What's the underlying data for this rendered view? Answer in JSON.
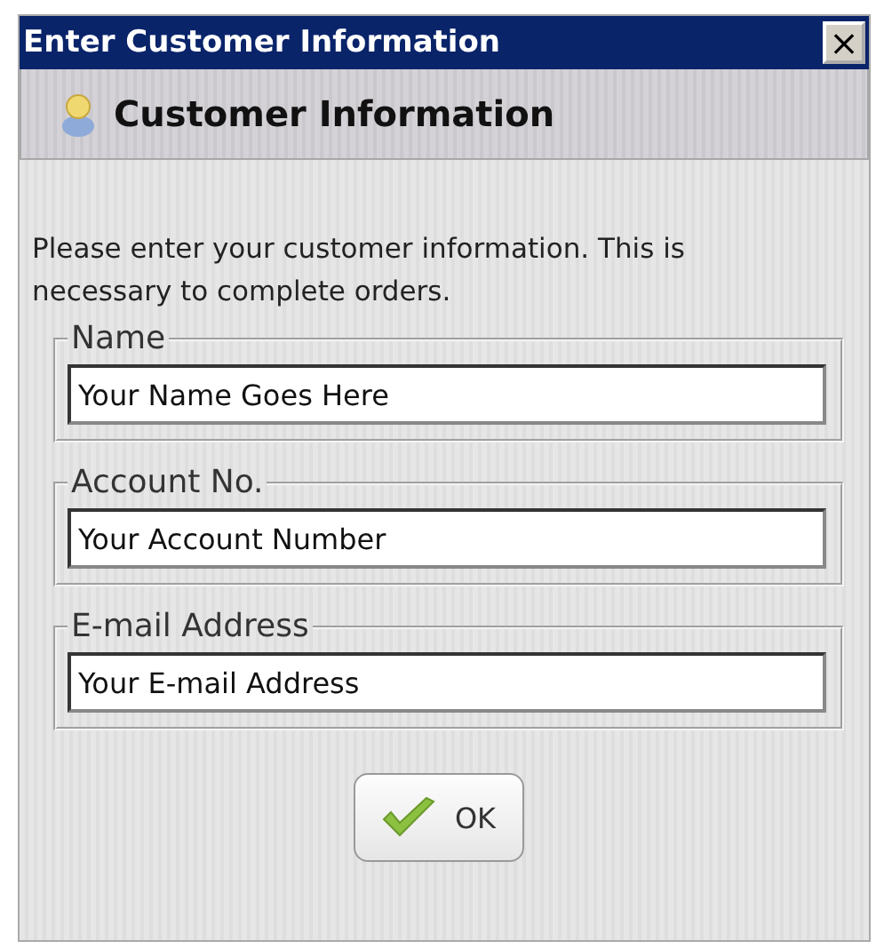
{
  "window": {
    "title": "Enter Customer Information",
    "close_label": "×"
  },
  "header": {
    "title": "Customer Information"
  },
  "intro": "Please enter your customer information. This is necessary to complete orders.",
  "fields": [
    {
      "label": "Name",
      "value": "Your Name Goes Here"
    },
    {
      "label": "Account No.",
      "value": "Your Account Number"
    },
    {
      "label": "E-mail Address",
      "value": "Your E-mail Address"
    }
  ],
  "buttons": [
    {
      "label": "OK"
    }
  ]
}
